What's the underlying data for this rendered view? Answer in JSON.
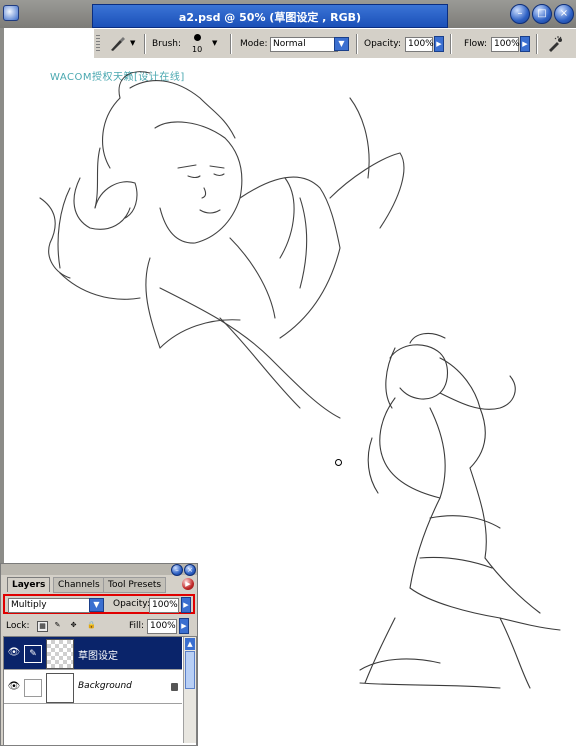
{
  "window": {
    "title": "a2.psd @ 50% (草图设定 , RGB)",
    "controls": [
      "minimize-icon",
      "maximize-icon",
      "close-icon"
    ]
  },
  "options_bar": {
    "brush_label": "Brush:",
    "brush_size": "10",
    "mode_label": "Mode:",
    "mode_value": "Normal",
    "opacity_label": "Opacity:",
    "opacity_value": "100%",
    "flow_label": "Flow:",
    "flow_value": "100%"
  },
  "canvas": {
    "watermark": "WACOM授权天籁[设计在线]"
  },
  "layers_panel": {
    "tabs": [
      "Layers",
      "Channels",
      "Tool Presets"
    ],
    "blend_mode": "Multiply",
    "opacity_label": "Opacity:",
    "opacity_value": "100%",
    "lock_label": "Lock:",
    "fill_label": "Fill:",
    "fill_value": "100%",
    "layers": [
      {
        "name": "草图设定",
        "selected": true
      },
      {
        "name": "Background",
        "selected": false,
        "locked": true
      }
    ]
  },
  "colors": {
    "title_blue": "#1b50b8",
    "highlight_red": "#e00000",
    "selection": "#0a246a",
    "panel_gray": "#d4d0c8"
  }
}
